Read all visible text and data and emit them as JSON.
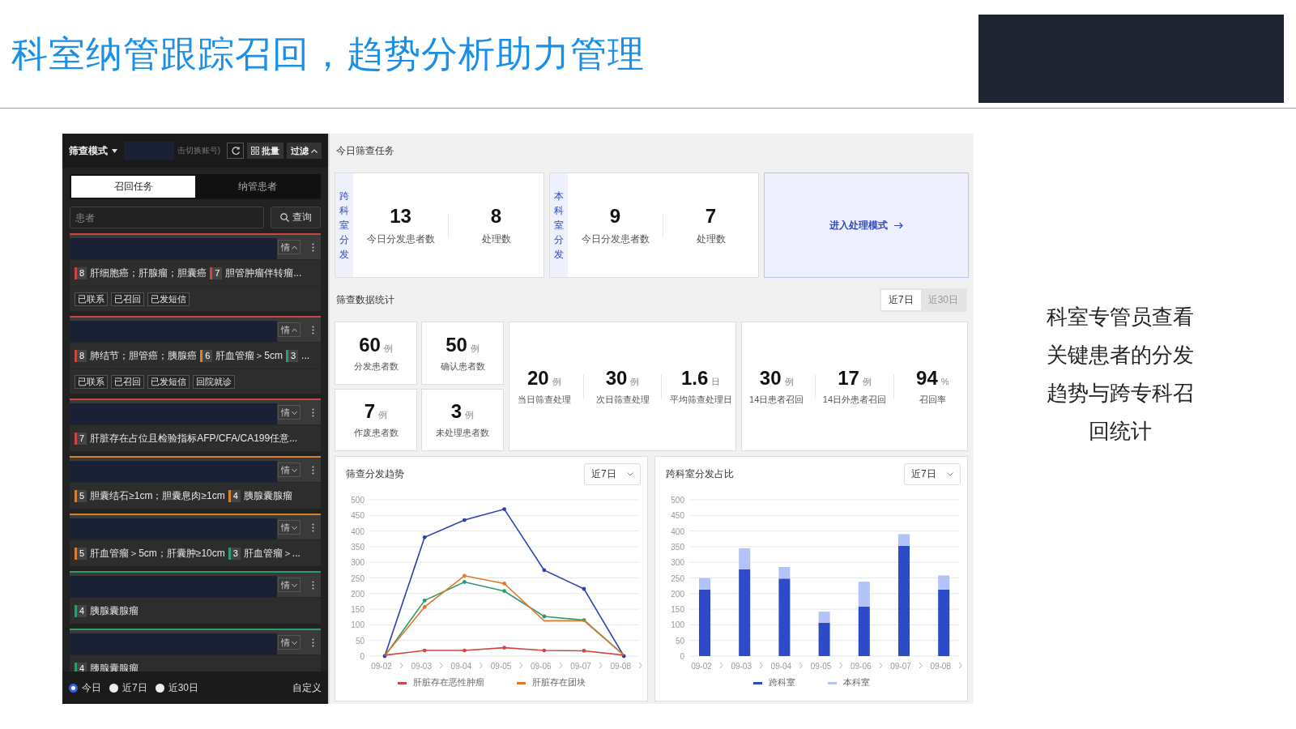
{
  "slide": {
    "title": "科室纳管跟踪召回，趋势分析助力管理",
    "caption": "科室专管员查看关键患者的分发趋势与跨专科召回统计"
  },
  "sidebar": {
    "mode_label": "筛查模式",
    "account_hint": "击切换账号)",
    "batch_label": "批量",
    "filter_label": "过滤",
    "tabs": [
      {
        "label": "召回任务",
        "selected": true
      },
      {
        "label": "纳管患者",
        "selected": false
      }
    ],
    "search": {
      "placeholder": "患者",
      "button": "查询"
    },
    "tasks": [
      {
        "color": "#c9473f",
        "expanded": true,
        "detail_label": "情",
        "diagnoses": [
          {
            "grade": "8",
            "color": "#c9473f",
            "text": "肝细胞癌；肝腺瘤；胆囊癌"
          },
          {
            "grade": "7",
            "color": "#c9473f",
            "text": "胆管肿瘤伴转瘤..."
          }
        ],
        "tags": [
          "已联系",
          "已召回",
          "已发短信"
        ]
      },
      {
        "color": "#c9473f",
        "expanded": true,
        "detail_label": "情",
        "diagnoses": [
          {
            "grade": "8",
            "color": "#c9473f",
            "text": "肺结节；胆管癌；胰腺癌"
          },
          {
            "grade": "6",
            "color": "#d9802e",
            "text": "肝血管瘤＞5cm"
          },
          {
            "grade": "3",
            "color": "#2f9a6c",
            "text": "..."
          }
        ],
        "tags": [
          "已联系",
          "已召回",
          "已发短信",
          "回院就诊"
        ]
      },
      {
        "color": "#c9473f",
        "expanded": false,
        "detail_label": "情",
        "diagnoses": [
          {
            "grade": "7",
            "color": "#c9473f",
            "text": "肝脏存在占位且检验指标AFP/CFA/CA199任意..."
          }
        ]
      },
      {
        "color": "#d9802e",
        "expanded": false,
        "detail_label": "情",
        "diagnoses": [
          {
            "grade": "5",
            "color": "#d9802e",
            "text": "胆囊结石≥1cm；胆囊息肉≥1cm"
          },
          {
            "grade": "4",
            "color": "#d9802e",
            "text": "胰腺囊腺瘤"
          }
        ]
      },
      {
        "color": "#d9802e",
        "expanded": false,
        "detail_label": "情",
        "diagnoses": [
          {
            "grade": "5",
            "color": "#d9802e",
            "text": "肝血管瘤＞5cm；肝囊肿≥10cm"
          },
          {
            "grade": "3",
            "color": "#2f9a6c",
            "text": "肝血管瘤＞..."
          }
        ]
      },
      {
        "color": "#2f9a6c",
        "expanded": false,
        "detail_label": "情",
        "diagnoses": [
          {
            "grade": "4",
            "color": "#2f9a6c",
            "text": "胰腺囊腺瘤"
          }
        ]
      },
      {
        "color": "#2f9a6c",
        "expanded": false,
        "detail_label": "情",
        "diagnoses": [
          {
            "grade": "4",
            "color": "#2f9a6c",
            "text": "胰腺囊腺瘤"
          }
        ]
      }
    ],
    "ranges": [
      {
        "label": "今日",
        "selected": true
      },
      {
        "label": "近7日",
        "selected": false
      },
      {
        "label": "近30日",
        "selected": false
      }
    ],
    "custom_label": "自定义"
  },
  "dashboard": {
    "today": {
      "title": "今日筛查任务",
      "groups": [
        {
          "label": "跨科室分发",
          "stats": [
            {
              "value": "13",
              "label": "今日分发患者数"
            },
            {
              "value": "8",
              "label": "处理数"
            }
          ]
        },
        {
          "label": "本科室分发",
          "stats": [
            {
              "value": "9",
              "label": "今日分发患者数"
            },
            {
              "value": "7",
              "label": "处理数"
            }
          ]
        }
      ],
      "action": "进入处理模式"
    },
    "stats": {
      "title": "筛查数据统计",
      "ranges": [
        {
          "label": "近7日",
          "selected": true
        },
        {
          "label": "近30日",
          "selected": false
        }
      ],
      "small": [
        {
          "value": "60",
          "unit": "例",
          "label": "分发患者数"
        },
        {
          "value": "50",
          "unit": "例",
          "label": "确认患者数"
        },
        {
          "value": "7",
          "unit": "例",
          "label": "作废患者数"
        },
        {
          "value": "3",
          "unit": "例",
          "label": "未处理患者数"
        }
      ],
      "groups": [
        [
          {
            "value": "20",
            "unit": "例",
            "label": "当日筛查处理"
          },
          {
            "value": "30",
            "unit": "例",
            "label": "次日筛查处理"
          },
          {
            "value": "1.6",
            "unit": "日",
            "label": "平均筛查处理日"
          }
        ],
        [
          {
            "value": "30",
            "unit": "例",
            "label": "14日患者召回"
          },
          {
            "value": "17",
            "unit": "例",
            "label": "14日外患者召回"
          },
          {
            "value": "94",
            "unit": "%",
            "label": "召回率"
          }
        ]
      ]
    },
    "charts": [
      {
        "title": "筛查分发趋势",
        "range": "近7日",
        "chart_data": {
          "type": "line",
          "categories": [
            "09-02",
            "09-03",
            "09-04",
            "09-05",
            "09-06",
            "09-07",
            "09-08"
          ],
          "yticks": [
            0,
            50,
            100,
            150,
            200,
            250,
            300,
            350,
            400,
            450,
            500
          ],
          "ylim": [
            0,
            500
          ],
          "grid": true,
          "series": [
            {
              "color": "#2b3fb0",
              "values": [
                0,
                380,
                435,
                470,
                275,
                215,
                0
              ]
            },
            {
              "color": "#2e9a6a",
              "values": [
                0,
                178,
                237,
                208,
                127,
                115,
                3
              ]
            },
            {
              "name": "肝脏存在团块",
              "color": "#e07a2a",
              "values": [
                2,
                157,
                257,
                232,
                113,
                113,
                3
              ]
            },
            {
              "name": "肝脏存在恶性肿瘤",
              "color": "#d0453f",
              "values": [
                3,
                18,
                18,
                27,
                18,
                17,
                3
              ]
            }
          ]
        }
      },
      {
        "title": "跨科室分发占比",
        "range": "近7日",
        "chart_data": {
          "type": "bar",
          "stacked": true,
          "categories": [
            "09-02",
            "09-03",
            "09-04",
            "09-05",
            "09-06",
            "09-07",
            "09-08"
          ],
          "yticks": [
            0,
            50,
            100,
            150,
            200,
            250,
            300,
            350,
            400,
            450,
            500
          ],
          "ylim": [
            0,
            500
          ],
          "grid": true,
          "series": [
            {
              "name": "跨科室",
              "color": "#2d4bc8",
              "values": [
                213,
                278,
                248,
                107,
                158,
                353,
                213
              ]
            },
            {
              "name": "本科室",
              "color": "#b3c3f7",
              "values": [
                37,
                67,
                37,
                35,
                80,
                37,
                45
              ]
            }
          ]
        }
      }
    ]
  }
}
